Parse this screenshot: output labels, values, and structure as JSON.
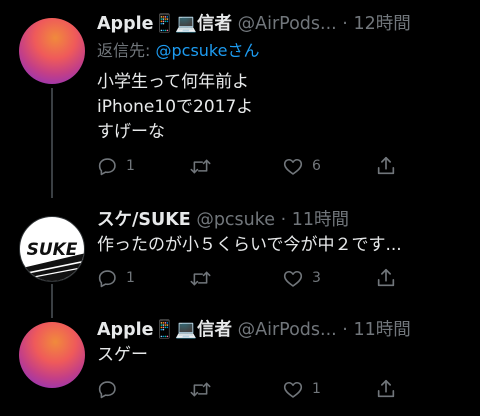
{
  "tweets": [
    {
      "name": "Apple📱💻信者",
      "handle": "@AirPods...",
      "dot": "·",
      "time": "12時間",
      "more": "···",
      "reply_prefix": "返信先:",
      "reply_link": "@pcsukeさん",
      "text": "小学生って何年前よ\niPhone10で2017よ\nすげーな",
      "replies": "1",
      "retweets": "",
      "likes": "6",
      "avatar": "gradient-orb-avatar"
    },
    {
      "name": "スケ/SUKE",
      "handle": "@pcsuke",
      "dot": "·",
      "time": "11時間",
      "more": "···",
      "text": "作ったのが小５くらいで今が中２です...",
      "replies": "1",
      "retweets": "",
      "likes": "3",
      "avatar": "suke-logo-avatar",
      "avatar_text": "SUKE"
    },
    {
      "name": "Apple📱💻信者",
      "handle": "@AirPods...",
      "dot": "·",
      "time": "11時間",
      "more": "···",
      "text": "スゲー",
      "replies": "",
      "retweets": "",
      "likes": "1",
      "avatar": "gradient-orb-avatar"
    }
  ],
  "icons": {
    "reply": "reply-icon",
    "retweet": "retweet-icon",
    "like": "heart-icon",
    "share": "share-icon"
  },
  "colors": {
    "background": "#000000",
    "text": "#e7e9ea",
    "muted": "#71767b",
    "link": "#1d9bf0"
  }
}
